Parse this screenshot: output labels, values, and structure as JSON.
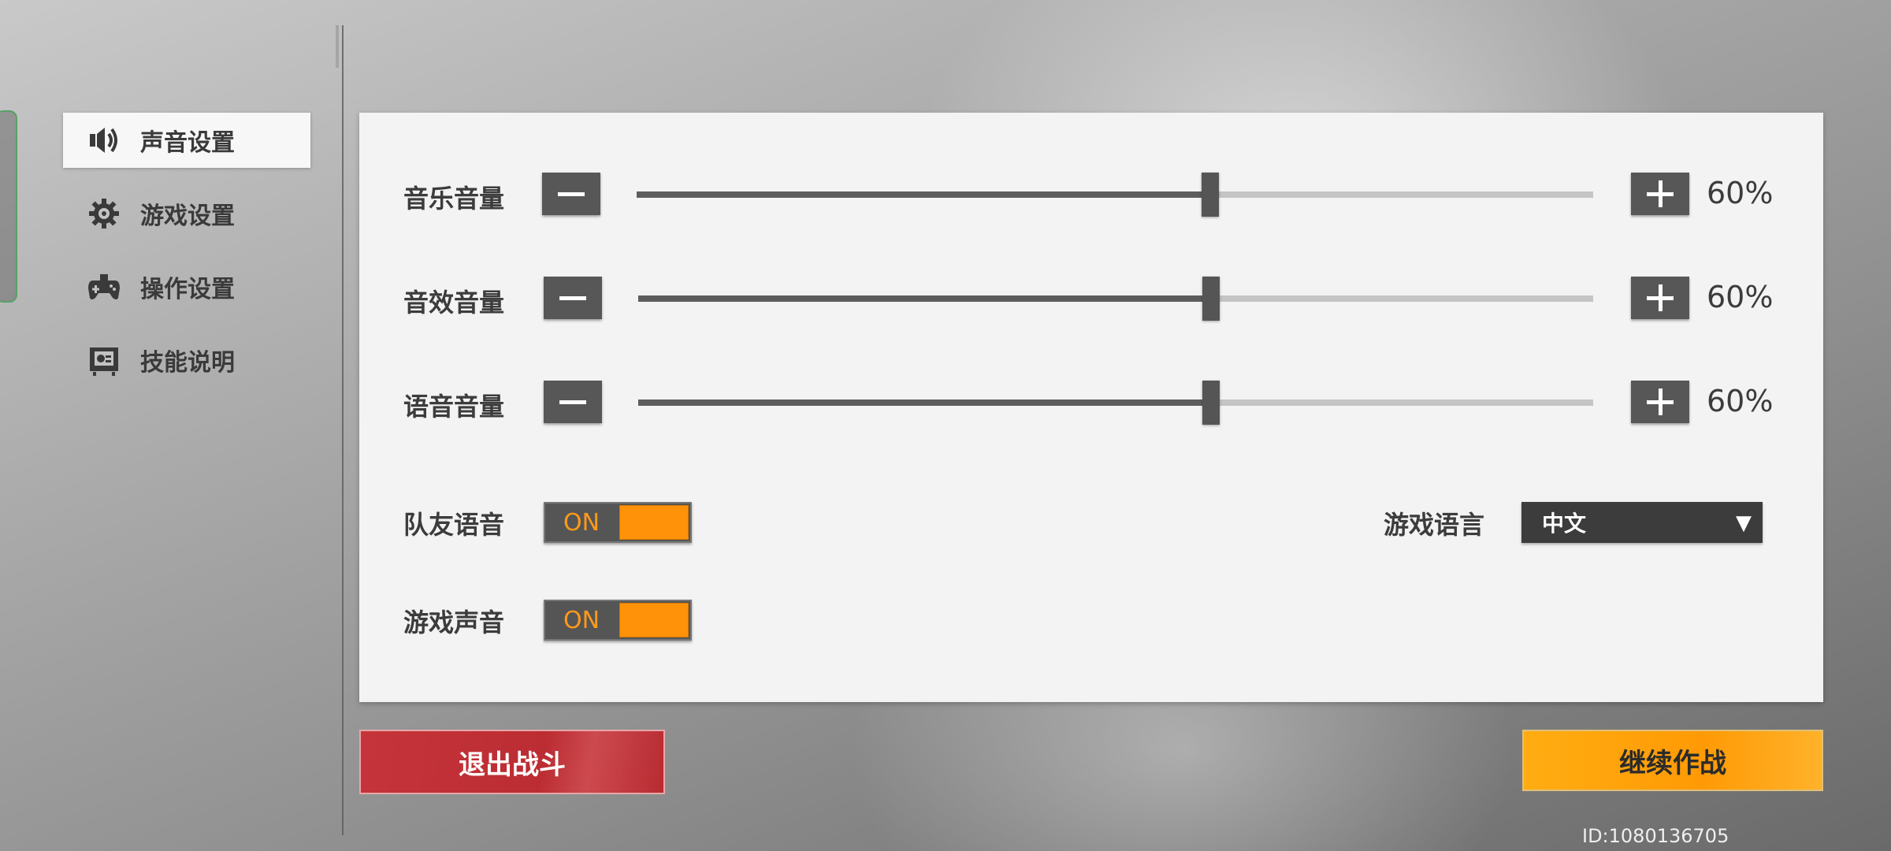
{
  "sidebar": {
    "items": [
      {
        "label": "声音设置",
        "icon": "speaker-icon",
        "active": true
      },
      {
        "label": "游戏设置",
        "icon": "gear-icon",
        "active": false
      },
      {
        "label": "操作设置",
        "icon": "gamepad-icon",
        "active": false
      },
      {
        "label": "技能说明",
        "icon": "skill-card-icon",
        "active": false
      }
    ]
  },
  "sound": {
    "music": {
      "label": "音乐音量",
      "value_text": "60%",
      "level": 0.6
    },
    "effect": {
      "label": "音效音量",
      "value_text": "60%",
      "level": 0.6
    },
    "voice": {
      "label": "语音音量",
      "value_text": "60%",
      "level": 0.6
    },
    "teammate_voice": {
      "label": "队友语音",
      "state": "ON"
    },
    "game_sound": {
      "label": "游戏声音",
      "state": "ON"
    },
    "language": {
      "label": "游戏语言",
      "selected": "中文",
      "caret": "▼"
    }
  },
  "actions": {
    "exit_label": "退出战斗",
    "continue_label": "继续作战"
  },
  "footer": {
    "id_text": "ID:1080136705"
  },
  "colors": {
    "accent_orange": "#ff9208",
    "exit_red": "#c5343a",
    "panel_bg": "#f3f3f3",
    "dark_control": "#575757"
  }
}
